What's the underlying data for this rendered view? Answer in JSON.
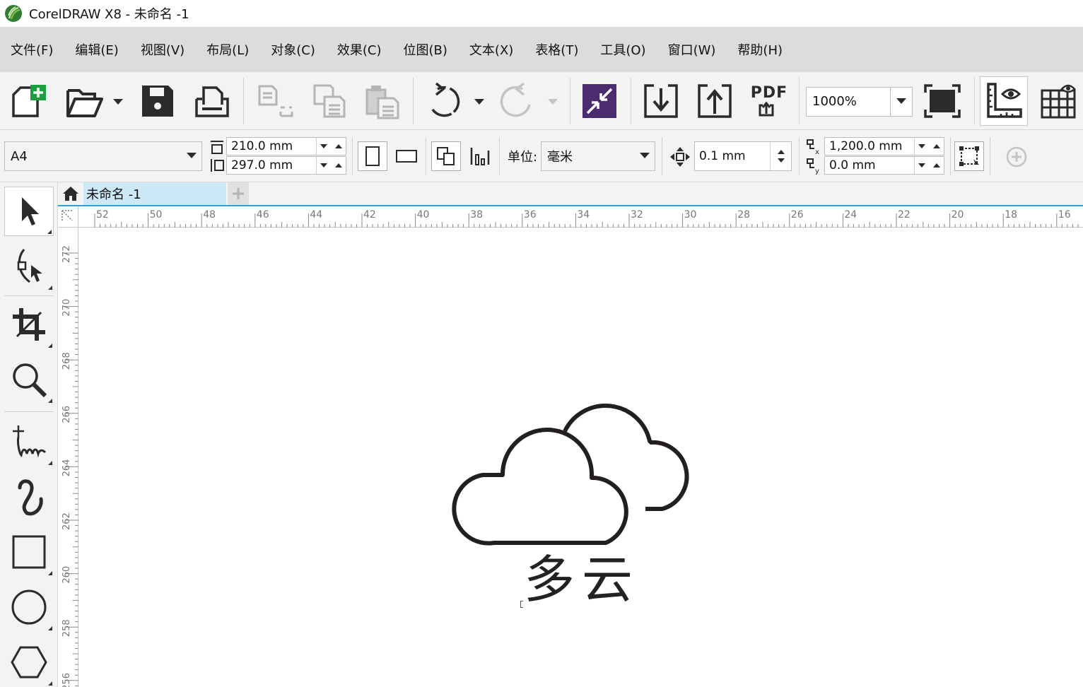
{
  "window": {
    "title": "CorelDRAW X8 - 未命名 -1"
  },
  "menu": [
    {
      "label": "文件(F)"
    },
    {
      "label": "编辑(E)"
    },
    {
      "label": "视图(V)"
    },
    {
      "label": "布局(L)"
    },
    {
      "label": "对象(C)"
    },
    {
      "label": "效果(C)"
    },
    {
      "label": "位图(B)"
    },
    {
      "label": "文本(X)"
    },
    {
      "label": "表格(T)"
    },
    {
      "label": "工具(O)"
    },
    {
      "label": "窗口(W)"
    },
    {
      "label": "帮助(H)"
    }
  ],
  "toolbar": {
    "zoom_level": "1000%",
    "pdf_label": "PDF",
    "icons": [
      "new-document-icon",
      "open-icon",
      "save-icon",
      "print-icon",
      "cut-icon",
      "copy-icon",
      "paste-icon",
      "undo-icon",
      "redo-icon",
      "search-content-icon",
      "import-icon",
      "export-icon",
      "publish-pdf-icon",
      "full-screen-icon",
      "rulers-icon",
      "grid-icon"
    ]
  },
  "propbar": {
    "page_size": "A4",
    "page_width": "210.0 mm",
    "page_height": "297.0 mm",
    "units_label": "单位:",
    "units_value": "毫米",
    "nudge": "0.1 mm",
    "dup_x": "1,200.0 mm",
    "dup_y": "0.0 mm"
  },
  "tabs": {
    "document": "未命名 -1"
  },
  "toolbox": [
    "pick-tool-icon",
    "shape-tool-icon",
    "crop-tool-icon",
    "zoom-tool-icon",
    "freehand-tool-icon",
    "artistic-media-icon",
    "rectangle-tool-icon",
    "ellipse-tool-icon",
    "polygon-tool-icon"
  ],
  "rulers": {
    "horizontal": [
      "52",
      "50",
      "48",
      "46",
      "44",
      "42",
      "40",
      "38",
      "36",
      "34",
      "32",
      "30",
      "28",
      "26",
      "24",
      "22",
      "20",
      "18",
      "16"
    ],
    "vertical": [
      "272",
      "270",
      "268",
      "266",
      "264",
      "262",
      "260",
      "258",
      "256"
    ]
  },
  "canvas": {
    "text": "多云",
    "icon": "cloud-icon"
  }
}
